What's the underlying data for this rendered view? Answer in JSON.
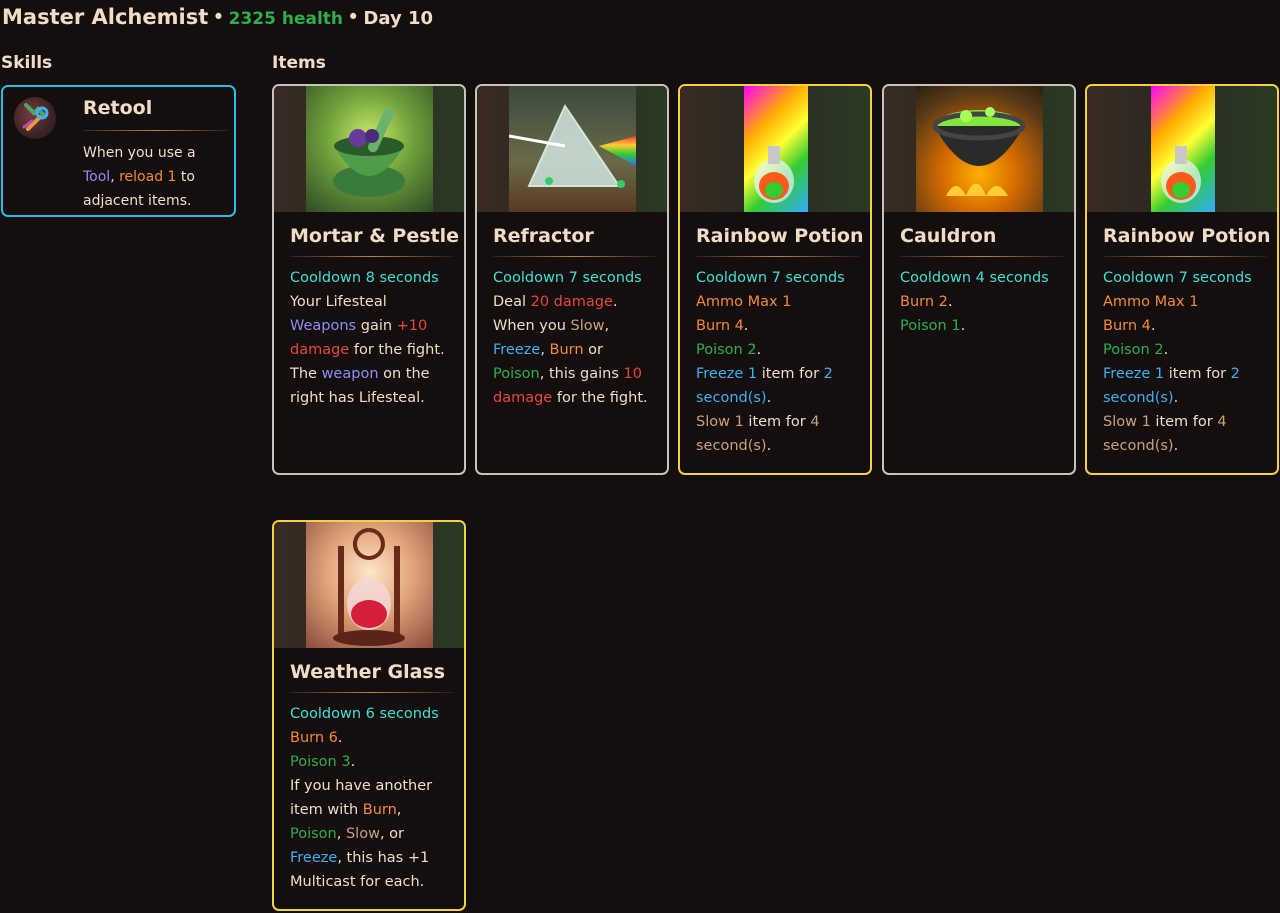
{
  "header": {
    "name": "Master Alchemist",
    "sep": "•",
    "health": "2325 health",
    "day": "Day 10"
  },
  "sections": {
    "skills": "Skills",
    "items": "Items"
  },
  "skill": {
    "title": "Retool",
    "icon": "wrench-tool-icon",
    "desc": [
      {
        "text": "When you use a",
        "color": ""
      },
      {
        "text": "Tool",
        "color": "purple"
      },
      {
        "text": ", ",
        "color": ""
      },
      {
        "text": "reload 1",
        "color": "orange"
      },
      {
        "text": " to adjacent items.",
        "color": ""
      }
    ]
  },
  "items": [
    {
      "title": "Mortar & Pestle",
      "border": "silver",
      "image": "mortar-pestle-image",
      "lines": [
        [
          {
            "t": "Cooldown 8 seconds",
            "c": "cyan"
          }
        ],
        [
          {
            "t": "Your Lifesteal ",
            "c": ""
          },
          {
            "t": "Weapons",
            "c": "purple"
          },
          {
            "t": " gain ",
            "c": ""
          },
          {
            "t": "+10 damage",
            "c": "red"
          },
          {
            "t": " for the fight. The ",
            "c": ""
          },
          {
            "t": "weapon",
            "c": "purple"
          },
          {
            "t": " on the right has Lifesteal.",
            "c": ""
          }
        ]
      ]
    },
    {
      "title": "Refractor",
      "border": "silver",
      "image": "prism-image",
      "lines": [
        [
          {
            "t": "Cooldown 7 seconds",
            "c": "cyan"
          }
        ],
        [
          {
            "t": "Deal ",
            "c": ""
          },
          {
            "t": "20 damage",
            "c": "red"
          },
          {
            "t": ".",
            "c": ""
          }
        ],
        [
          {
            "t": "When you ",
            "c": ""
          },
          {
            "t": "Slow",
            "c": "tan"
          },
          {
            "t": ", ",
            "c": ""
          },
          {
            "t": "Freeze",
            "c": "blue"
          },
          {
            "t": ", ",
            "c": ""
          },
          {
            "t": "Burn",
            "c": "orange"
          },
          {
            "t": " or ",
            "c": ""
          },
          {
            "t": "Poison",
            "c": "green"
          },
          {
            "t": ", this gains ",
            "c": ""
          },
          {
            "t": "10 damage",
            "c": "red"
          },
          {
            "t": " for the fight.",
            "c": ""
          }
        ]
      ]
    },
    {
      "title": "Rainbow Potion",
      "border": "gold",
      "image": "rainbow-potion-image",
      "lines": [
        [
          {
            "t": "Cooldown 7 seconds",
            "c": "cyan"
          }
        ],
        [
          {
            "t": "Ammo Max 1",
            "c": "orange"
          }
        ],
        [
          {
            "t": "Burn 4",
            "c": "orange"
          },
          {
            "t": ".",
            "c": ""
          }
        ],
        [
          {
            "t": "Poison 2",
            "c": "green"
          },
          {
            "t": ".",
            "c": ""
          }
        ],
        [
          {
            "t": "Freeze 1",
            "c": "blue"
          },
          {
            "t": " item for ",
            "c": ""
          },
          {
            "t": "2 second(s)",
            "c": "blue"
          },
          {
            "t": ".",
            "c": ""
          }
        ],
        [
          {
            "t": "Slow 1",
            "c": "tan"
          },
          {
            "t": " item for ",
            "c": ""
          },
          {
            "t": "4 second(s)",
            "c": "tan"
          },
          {
            "t": ".",
            "c": ""
          }
        ]
      ]
    },
    {
      "title": "Cauldron",
      "border": "silver",
      "image": "cauldron-image",
      "lines": [
        [
          {
            "t": "Cooldown 4 seconds",
            "c": "cyan"
          }
        ],
        [
          {
            "t": "Burn 2",
            "c": "orange"
          },
          {
            "t": ".",
            "c": ""
          }
        ],
        [
          {
            "t": "Poison 1",
            "c": "green"
          },
          {
            "t": ".",
            "c": ""
          }
        ]
      ]
    },
    {
      "title": "Rainbow Potion",
      "border": "gold",
      "image": "rainbow-potion-image",
      "lines": [
        [
          {
            "t": "Cooldown 7 seconds",
            "c": "cyan"
          }
        ],
        [
          {
            "t": "Ammo Max 1",
            "c": "orange"
          }
        ],
        [
          {
            "t": "Burn 4",
            "c": "orange"
          },
          {
            "t": ".",
            "c": ""
          }
        ],
        [
          {
            "t": "Poison 2",
            "c": "green"
          },
          {
            "t": ".",
            "c": ""
          }
        ],
        [
          {
            "t": "Freeze 1",
            "c": "blue"
          },
          {
            "t": " item for ",
            "c": ""
          },
          {
            "t": "2 second(s)",
            "c": "blue"
          },
          {
            "t": ".",
            "c": ""
          }
        ],
        [
          {
            "t": "Slow 1",
            "c": "tan"
          },
          {
            "t": " item for ",
            "c": ""
          },
          {
            "t": "4 second(s)",
            "c": "tan"
          },
          {
            "t": ".",
            "c": ""
          }
        ]
      ]
    },
    {
      "title": "Weather Glass",
      "border": "gold",
      "image": "weather-glass-image",
      "lines": [
        [
          {
            "t": "Cooldown 6 seconds",
            "c": "cyan"
          }
        ],
        [
          {
            "t": "Burn 6",
            "c": "orange"
          },
          {
            "t": ".",
            "c": ""
          }
        ],
        [
          {
            "t": "Poison 3",
            "c": "green"
          },
          {
            "t": ".",
            "c": ""
          }
        ],
        [
          {
            "t": "If you have another item with ",
            "c": ""
          },
          {
            "t": "Burn",
            "c": "orange"
          },
          {
            "t": ", ",
            "c": ""
          },
          {
            "t": "Poison",
            "c": "green"
          },
          {
            "t": ", ",
            "c": ""
          },
          {
            "t": "Slow",
            "c": "tan"
          },
          {
            "t": ", or ",
            "c": ""
          },
          {
            "t": "Freeze",
            "c": "blue"
          },
          {
            "t": ", this has +1 Multicast for each.",
            "c": ""
          }
        ]
      ]
    }
  ],
  "colors": {
    "background": "#150e0e",
    "text": "#f1dcc6",
    "cyan": "#3fe0d3",
    "red": "#e8473c",
    "orange": "#f28a3a",
    "green": "#2fae4c",
    "blue": "#3fb1f2",
    "purple": "#8f8cf4",
    "tan": "#c9a07a",
    "skill_border": "#2bbbe6",
    "silver_border": "#c9c3bf",
    "gold_border": "#f4d23f"
  }
}
